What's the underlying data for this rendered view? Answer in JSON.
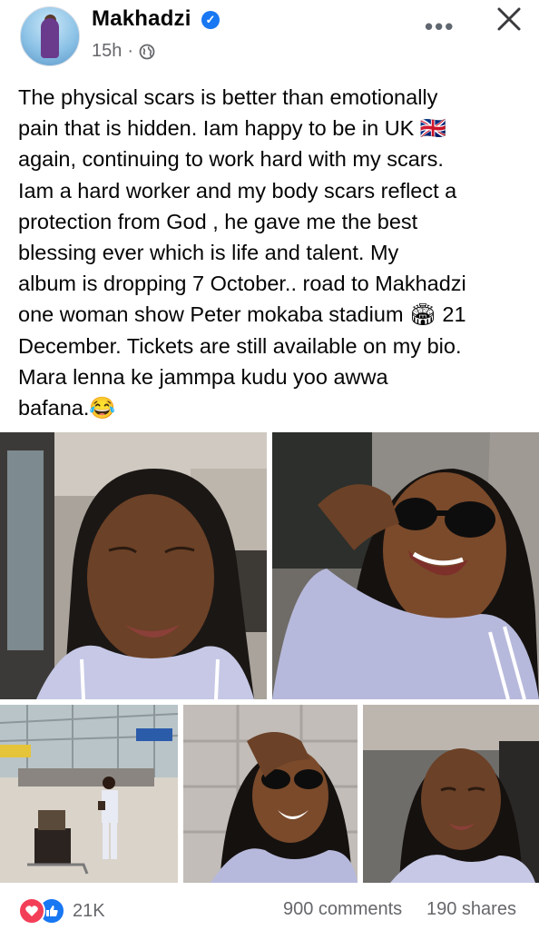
{
  "post": {
    "author": "Makhadzi",
    "time": "15h",
    "separator": "·",
    "text_lines": [
      "The physical scars is better than emotionally",
      "pain that is hidden. Iam happy to be in UK 🇬🇧",
      "again, continuing to work hard with my scars.",
      "Iam a hard worker and my body scars reflect a",
      "protection from God , he gave me the best",
      "blessing ever which is life and talent.  My",
      "album is dropping 7 October.. road to Makhadzi",
      "one woman show Peter mokaba stadium 🏟 21",
      "December. Tickets are still available on my bio.",
      "Mara lenna ke  jammpa kudu yoo awwa",
      "bafana.😂"
    ]
  },
  "icons": {
    "verified": "verified-badge-icon",
    "audience": "globe-icon",
    "more": "more-options-icon",
    "close": "close-icon",
    "love": "love-reaction-icon",
    "like": "like-reaction-icon"
  },
  "photos": [
    {
      "desc": "car-selfie"
    },
    {
      "desc": "sunglasses-selfie"
    },
    {
      "desc": "airport"
    },
    {
      "desc": "wall-selfie"
    },
    {
      "desc": "car-selfie-2"
    }
  ],
  "engagement": {
    "reaction_count": "21K",
    "comments": "900 comments",
    "shares": "190 shares"
  },
  "colors": {
    "brand_blue": "#1877f2",
    "love_red": "#f33e58",
    "meta_gray": "#65676b"
  }
}
